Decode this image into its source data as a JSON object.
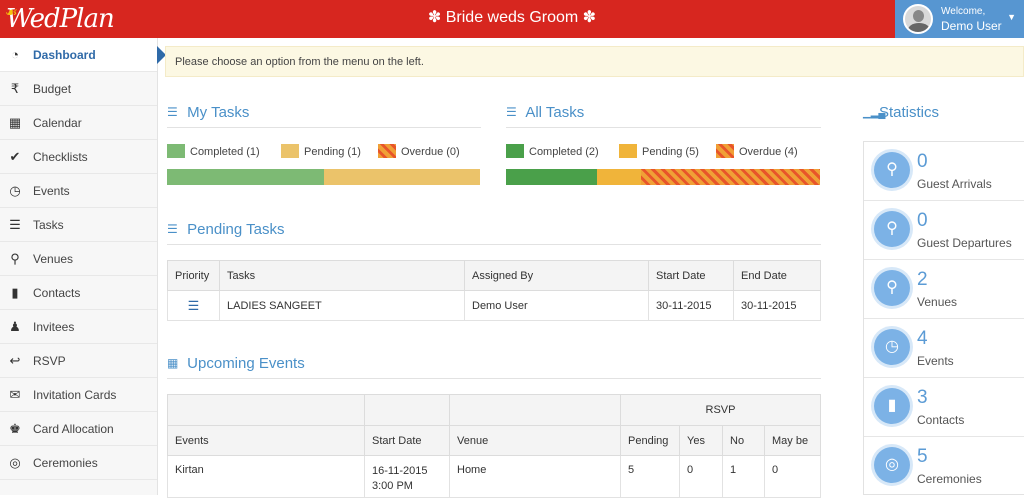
{
  "header": {
    "logo_text": "WedPlan",
    "title": "✽ Bride weds Groom ✽",
    "welcome": "Welcome,",
    "user": "Demo User"
  },
  "sidebar": {
    "items": [
      {
        "label": "Dashboard",
        "icon": "dashboard-icon",
        "glyph": "◔",
        "active": true
      },
      {
        "label": "Budget",
        "icon": "rupee-icon",
        "glyph": "₹"
      },
      {
        "label": "Calendar",
        "icon": "calendar-icon",
        "glyph": "▦"
      },
      {
        "label": "Checklists",
        "icon": "check-icon",
        "glyph": "✔"
      },
      {
        "label": "Events",
        "icon": "calendar-clock-icon",
        "glyph": "◷"
      },
      {
        "label": "Tasks",
        "icon": "tasks-icon",
        "glyph": "☰"
      },
      {
        "label": "Venues",
        "icon": "map-marker-icon",
        "glyph": "⚲"
      },
      {
        "label": "Contacts",
        "icon": "address-book-icon",
        "glyph": "▮"
      },
      {
        "label": "Invitees",
        "icon": "users-icon",
        "glyph": "♟"
      },
      {
        "label": "RSVP",
        "icon": "reply-icon",
        "glyph": "↩"
      },
      {
        "label": "Invitation Cards",
        "icon": "envelope-icon",
        "glyph": "✉"
      },
      {
        "label": "Card Allocation",
        "icon": "card-allocation-icon",
        "glyph": "♚"
      },
      {
        "label": "Ceremonies",
        "icon": "rings-icon",
        "glyph": "◎"
      }
    ]
  },
  "alert": "Please choose an option from the menu on the left.",
  "my_tasks": {
    "title": "My Tasks",
    "completed": "Completed (1)",
    "pending": "Pending (1)",
    "overdue": "Overdue (0)",
    "progress": {
      "completed": 0.5,
      "pending": 0.5,
      "overdue": 0
    }
  },
  "all_tasks": {
    "title": "All Tasks",
    "completed": "Completed (2)",
    "pending": "Pending (5)",
    "overdue": "Overdue (4)",
    "progress": {
      "completed": 0.29,
      "pending": 0.14,
      "overdue": 0.57
    }
  },
  "pending_tasks": {
    "title": "Pending Tasks",
    "headers": {
      "priority": "Priority",
      "tasks": "Tasks",
      "assigned": "Assigned By",
      "start": "Start Date",
      "end": "End Date"
    },
    "rows": [
      {
        "task": "LADIES SANGEET",
        "assigned": "Demo User",
        "start": "30-11-2015",
        "end": "30-11-2015"
      }
    ]
  },
  "upcoming_events": {
    "title": "Upcoming Events",
    "headers": {
      "rsvp": "RSVP",
      "events": "Events",
      "start": "Start Date",
      "venue": "Venue",
      "pending": "Pending",
      "yes": "Yes",
      "no": "No",
      "maybe": "May be"
    },
    "rows": [
      {
        "event": "Kirtan",
        "start_date": "16-11-2015",
        "start_time": "3:00 PM",
        "venue": "Home",
        "pending": "5",
        "yes": "0",
        "no": "1",
        "maybe": "0"
      }
    ]
  },
  "statistics": {
    "title": "Statistics",
    "items": [
      {
        "value": "0",
        "label": "Guest Arrivals",
        "icon": "map-marker-icon"
      },
      {
        "value": "0",
        "label": "Guest Departures",
        "icon": "map-marker-icon"
      },
      {
        "value": "2",
        "label": "Venues",
        "icon": "map-marker-icon"
      },
      {
        "value": "4",
        "label": "Events",
        "icon": "calendar-clock-icon"
      },
      {
        "value": "3",
        "label": "Contacts",
        "icon": "book-icon"
      },
      {
        "value": "5",
        "label": "Ceremonies",
        "icon": "rings-icon"
      }
    ]
  },
  "colors": {
    "header_red": "#d7261f",
    "user_blue": "#5796d1",
    "completed_green": "#7dba74",
    "completed_dark": "#4aa04a",
    "pending_amber": "#ebc36a",
    "pending_dark": "#f0b43a",
    "accent_blue": "#4a90c8"
  }
}
